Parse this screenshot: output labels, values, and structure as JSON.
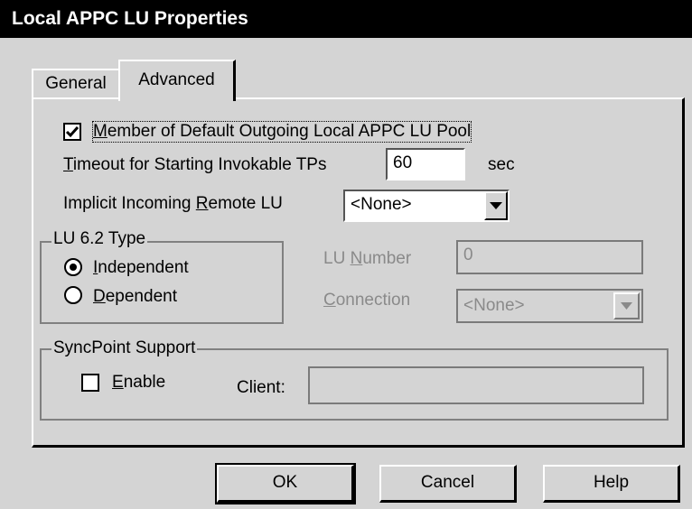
{
  "window": {
    "title": "Local APPC LU Properties"
  },
  "tabs": {
    "general": "General",
    "advanced": "Advanced"
  },
  "advanced": {
    "member_pool": {
      "prefix": "",
      "accel": "M",
      "rest": "ember of Default Outgoing Local APPC LU Pool",
      "checked": true
    },
    "timeout": {
      "accel": "T",
      "rest": "imeout for Starting Invokable TPs",
      "value": "60",
      "unit": "sec"
    },
    "implicit_remote": {
      "before": "Implicit Incoming ",
      "accel": "R",
      "rest": "emote LU",
      "value": "<None>"
    },
    "lu_type": {
      "legend": "LU 6.2 Type",
      "independent": {
        "accel": "I",
        "rest": "ndependent",
        "selected": true
      },
      "dependent": {
        "accel": "D",
        "rest": "ependent",
        "selected": false
      }
    },
    "lu_number": {
      "before": "LU ",
      "accel": "N",
      "rest": "umber",
      "value": "0"
    },
    "connection": {
      "accel": "C",
      "rest": "onnection",
      "value": "<None>"
    },
    "syncpoint": {
      "legend": "SyncPoint Support",
      "enable": {
        "accel": "E",
        "rest": "nable",
        "checked": false
      },
      "client_label": "Client:",
      "client_value": ""
    }
  },
  "buttons": {
    "ok": "OK",
    "cancel": "Cancel",
    "help": "Help"
  }
}
